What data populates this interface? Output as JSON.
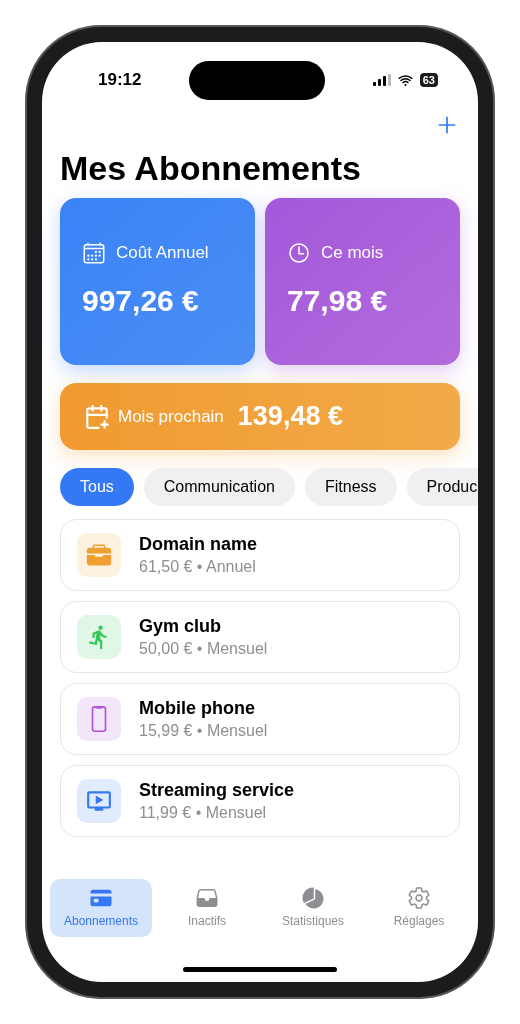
{
  "status_bar": {
    "time": "19:12",
    "battery": "63"
  },
  "title": "Mes Abonnements",
  "summary_cards": [
    {
      "kind": "annual",
      "label": "Coût Annuel",
      "value": "997,26 €"
    },
    {
      "kind": "month",
      "label": "Ce mois",
      "value": "77,98 €"
    }
  ],
  "next_month": {
    "label": "Mois prochain",
    "value": "139,48 €"
  },
  "filters": [
    {
      "label": "Tous",
      "selected": true
    },
    {
      "label": "Communication",
      "selected": false
    },
    {
      "label": "Fitness",
      "selected": false
    },
    {
      "label": "Produc",
      "selected": false
    }
  ],
  "subscriptions": [
    {
      "kind": "briefcase",
      "color": "#f0a030",
      "name": "Domain name",
      "details": "61,50 € • Annuel"
    },
    {
      "kind": "runner",
      "color": "#34c759",
      "name": "Gym club",
      "details": "50,00 € • Mensuel"
    },
    {
      "kind": "phone",
      "color": "#af52de",
      "name": "Mobile phone",
      "details": "15,99 € • Mensuel"
    },
    {
      "kind": "tv",
      "color": "#3478f6",
      "name": "Streaming service",
      "details": "11,99 € • Mensuel"
    }
  ],
  "tab_bar": [
    {
      "kind": "card",
      "label": "Abonnements",
      "selected": true
    },
    {
      "kind": "tray",
      "label": "Inactifs",
      "selected": false
    },
    {
      "kind": "pie",
      "label": "Statistiques",
      "selected": false
    },
    {
      "kind": "gear",
      "label": "Réglages",
      "selected": false
    }
  ]
}
